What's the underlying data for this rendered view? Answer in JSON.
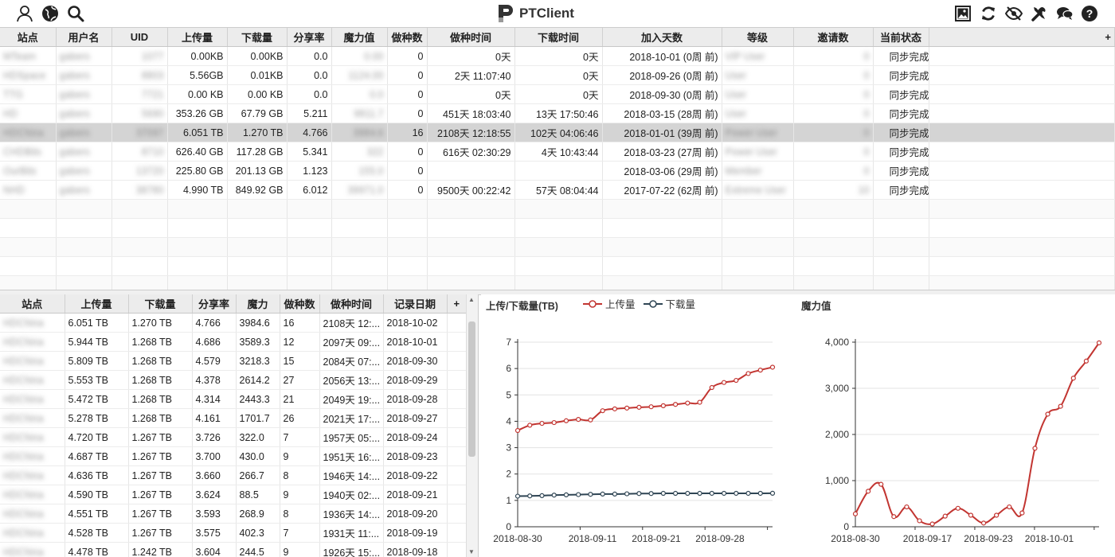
{
  "app": {
    "title": "PTClient"
  },
  "toolbar": {
    "left_icons": [
      "user-icon",
      "globe-icon",
      "search-icon"
    ],
    "right_icons": [
      "image-icon",
      "refresh-icon",
      "eye-off-icon",
      "tools-icon",
      "chat-icon",
      "help-icon"
    ]
  },
  "top_table": {
    "headers": [
      "站点",
      "用户名",
      "UID",
      "上传量",
      "下载量",
      "分享率",
      "魔力值",
      "做种数",
      "做种时间",
      "下载时间",
      "加入天数",
      "等级",
      "邀请数",
      "当前状态"
    ],
    "add_column": "+",
    "rows": [
      {
        "site": "MTeam",
        "user": "gabers",
        "uid": "1077",
        "upload": "0.00KB",
        "download": "0.00KB",
        "ratio": "0.0",
        "bonus": "0.00",
        "seeding": "0",
        "seed_time": "0天",
        "dl_time": "0天",
        "join": "2018-10-01 (0周 前)",
        "level": "VIP User",
        "invites": "0",
        "status": "同步完成"
      },
      {
        "site": "HDSpace",
        "user": "gabers",
        "uid": "8803",
        "upload": "5.56GB",
        "download": "0.01KB",
        "ratio": "0.0",
        "bonus": "1124.00",
        "seeding": "0",
        "seed_time": "2天 11:07:40",
        "dl_time": "0天",
        "join": "2018-09-26 (0周 前)",
        "level": "User",
        "invites": "0",
        "status": "同步完成"
      },
      {
        "site": "TTG",
        "user": "gabers",
        "uid": "7721",
        "upload": "0.00 KB",
        "download": "0.00 KB",
        "ratio": "0.0",
        "bonus": "0.0",
        "seeding": "0",
        "seed_time": "0天",
        "dl_time": "0天",
        "join": "2018-09-30 (0周 前)",
        "level": "User",
        "invites": "0",
        "status": "同步完成"
      },
      {
        "site": "HD",
        "user": "gabers",
        "uid": "5690",
        "upload": "353.26 GB",
        "download": "67.79 GB",
        "ratio": "5.211",
        "bonus": "9811.7",
        "seeding": "0",
        "seed_time": "451天 18:03:40",
        "dl_time": "13天 17:50:46",
        "join": "2018-03-15 (28周 前)",
        "level": "User",
        "invites": "0",
        "status": "同步完成"
      },
      {
        "site": "HDChina",
        "user": "gabers",
        "uid": "37097",
        "upload": "6.051 TB",
        "download": "1.270 TB",
        "ratio": "4.766",
        "bonus": "3984.6",
        "seeding": "16",
        "seed_time": "2108天 12:18:55",
        "dl_time": "102天 04:06:46",
        "join": "2018-01-01 (39周 前)",
        "level": "Power User",
        "invites": "0",
        "status": "同步完成",
        "selected": true
      },
      {
        "site": "CHDBits",
        "user": "gabers",
        "uid": "8710",
        "upload": "626.40 GB",
        "download": "117.28 GB",
        "ratio": "5.341",
        "bonus": "322",
        "seeding": "0",
        "seed_time": "616天 02:30:29",
        "dl_time": "4天 10:43:44",
        "join": "2018-03-23 (27周 前)",
        "level": "Power User",
        "invites": "0",
        "status": "同步完成"
      },
      {
        "site": "OurBits",
        "user": "gabers",
        "uid": "13720",
        "upload": "225.80 GB",
        "download": "201.13 GB",
        "ratio": "1.123",
        "bonus": "155.0",
        "seeding": "0",
        "seed_time": "",
        "dl_time": "",
        "join": "2018-03-06 (29周 前)",
        "level": "Member",
        "invites": "0",
        "status": "同步完成"
      },
      {
        "site": "NHD",
        "user": "gabers",
        "uid": "38780",
        "upload": "4.990 TB",
        "download": "849.92 GB",
        "ratio": "6.012",
        "bonus": "39971.0",
        "seeding": "0",
        "seed_time": "9500天 00:22:42",
        "dl_time": "57天 08:04:44",
        "join": "2017-07-22 (62周 前)",
        "level": "Extreme User",
        "invites": "10",
        "status": "同步完成"
      }
    ]
  },
  "history_table": {
    "headers": [
      "站点",
      "上传量",
      "下载量",
      "分享率",
      "魔力",
      "做种数",
      "做种时间",
      "记录日期"
    ],
    "add_column": "+",
    "rows": [
      {
        "site": "HDChina",
        "upload": "6.051 TB",
        "download": "1.270 TB",
        "ratio": "4.766",
        "bonus": "3984.6",
        "seeding": "16",
        "seed_time": "2108天 12:...",
        "date": "2018-10-02"
      },
      {
        "site": "HDChina",
        "upload": "5.944 TB",
        "download": "1.268 TB",
        "ratio": "4.686",
        "bonus": "3589.3",
        "seeding": "12",
        "seed_time": "2097天 09:...",
        "date": "2018-10-01"
      },
      {
        "site": "HDChina",
        "upload": "5.809 TB",
        "download": "1.268 TB",
        "ratio": "4.579",
        "bonus": "3218.3",
        "seeding": "15",
        "seed_time": "2084天 07:...",
        "date": "2018-09-30"
      },
      {
        "site": "HDChina",
        "upload": "5.553 TB",
        "download": "1.268 TB",
        "ratio": "4.378",
        "bonus": "2614.2",
        "seeding": "27",
        "seed_time": "2056天 13:...",
        "date": "2018-09-29"
      },
      {
        "site": "HDChina",
        "upload": "5.472 TB",
        "download": "1.268 TB",
        "ratio": "4.314",
        "bonus": "2443.3",
        "seeding": "21",
        "seed_time": "2049天 19:...",
        "date": "2018-09-28"
      },
      {
        "site": "HDChina",
        "upload": "5.278 TB",
        "download": "1.268 TB",
        "ratio": "4.161",
        "bonus": "1701.7",
        "seeding": "26",
        "seed_time": "2021天 17:...",
        "date": "2018-09-27"
      },
      {
        "site": "HDChina",
        "upload": "4.720 TB",
        "download": "1.267 TB",
        "ratio": "3.726",
        "bonus": "322.0",
        "seeding": "7",
        "seed_time": "1957天 05:...",
        "date": "2018-09-24"
      },
      {
        "site": "HDChina",
        "upload": "4.687 TB",
        "download": "1.267 TB",
        "ratio": "3.700",
        "bonus": "430.0",
        "seeding": "9",
        "seed_time": "1951天 16:...",
        "date": "2018-09-23"
      },
      {
        "site": "HDChina",
        "upload": "4.636 TB",
        "download": "1.267 TB",
        "ratio": "3.660",
        "bonus": "266.7",
        "seeding": "8",
        "seed_time": "1946天 14:...",
        "date": "2018-09-22"
      },
      {
        "site": "HDChina",
        "upload": "4.590 TB",
        "download": "1.267 TB",
        "ratio": "3.624",
        "bonus": "88.5",
        "seeding": "9",
        "seed_time": "1940天 02:...",
        "date": "2018-09-21"
      },
      {
        "site": "HDChina",
        "upload": "4.551 TB",
        "download": "1.267 TB",
        "ratio": "3.593",
        "bonus": "268.9",
        "seeding": "8",
        "seed_time": "1936天 14:...",
        "date": "2018-09-20"
      },
      {
        "site": "HDChina",
        "upload": "4.528 TB",
        "download": "1.267 TB",
        "ratio": "3.575",
        "bonus": "402.3",
        "seeding": "7",
        "seed_time": "1931天 11:...",
        "date": "2018-09-19"
      },
      {
        "site": "HDChina",
        "upload": "4.478 TB",
        "download": "1.242 TB",
        "ratio": "3.604",
        "bonus": "244.5",
        "seeding": "9",
        "seed_time": "1926天 15:...",
        "date": "2018-09-18"
      }
    ]
  },
  "chart_data": [
    {
      "type": "line",
      "title": "上传/下载量(TB)",
      "ylim": [
        0,
        7
      ],
      "yticks": [
        0,
        1,
        2,
        3,
        4,
        5,
        6,
        7
      ],
      "xtick_labels": [
        "2018-08-30",
        "2018-09-11",
        "2018-09-21",
        "2018-09-28"
      ],
      "grid": true,
      "legend_placement": "top",
      "series": [
        {
          "name": "上传量",
          "color": "#c23531",
          "values": [
            3.65,
            3.85,
            3.92,
            3.95,
            4.02,
            4.07,
            4.05,
            4.4,
            4.47,
            4.5,
            4.53,
            4.55,
            4.59,
            4.64,
            4.69,
            4.72,
            5.28,
            5.47,
            5.55,
            5.81,
            5.94,
            6.05
          ]
        },
        {
          "name": "下载量",
          "color": "#2f4554",
          "values": [
            1.16,
            1.17,
            1.18,
            1.2,
            1.21,
            1.22,
            1.23,
            1.24,
            1.24,
            1.25,
            1.26,
            1.26,
            1.267,
            1.267,
            1.267,
            1.267,
            1.268,
            1.268,
            1.268,
            1.268,
            1.268,
            1.27
          ]
        }
      ]
    },
    {
      "type": "line",
      "title": "魔力值",
      "ylim": [
        0,
        4000
      ],
      "yticks": [
        0,
        1000,
        2000,
        3000,
        4000
      ],
      "ytick_labels": [
        "0",
        "1,000",
        "2,000",
        "3,000",
        "4,000"
      ],
      "xtick_labels": [
        "2018-08-30",
        "2018-09-17",
        "2018-09-23",
        "2018-10-01"
      ],
      "grid": true,
      "series": [
        {
          "color": "#c23531",
          "values": [
            280,
            770,
            920,
            220,
            430,
            130,
            60,
            230,
            400,
            250,
            80,
            250,
            430,
            300,
            1700,
            2440,
            2610,
            3220,
            3590,
            3985
          ]
        }
      ]
    }
  ]
}
